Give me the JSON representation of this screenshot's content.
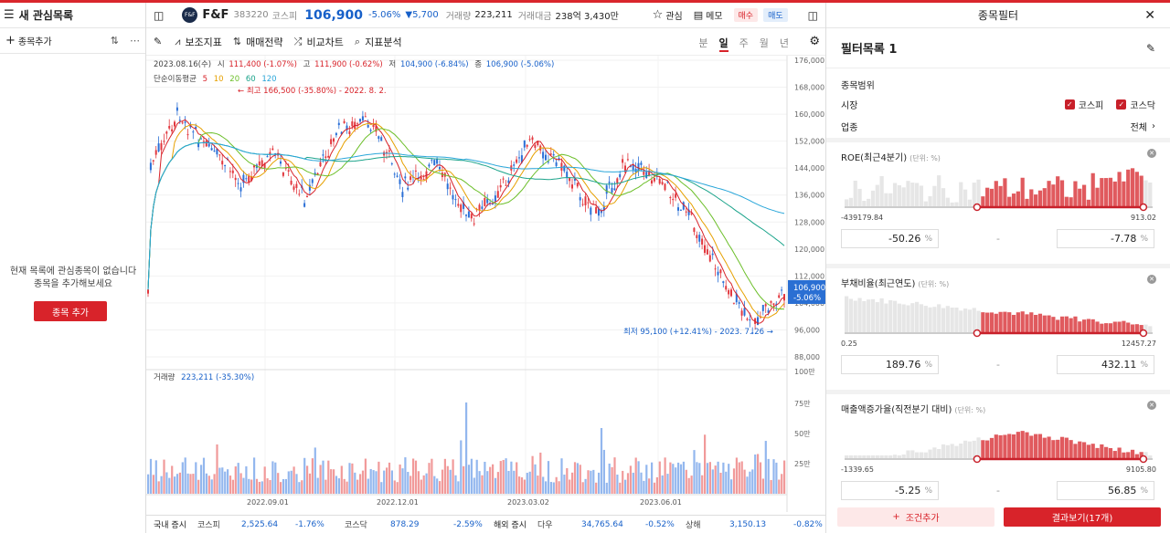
{
  "watchlist": {
    "title": "새 관심목록",
    "add_label": "종목추가",
    "empty_line1": "현재 목록에 관심종목이 없습니다",
    "empty_line2": "종목을 추가해보세요",
    "add_button": "종목 추가"
  },
  "stock": {
    "logo": "F&F",
    "name": "F&F",
    "code": "383220",
    "market": "코스피",
    "price": "106,900",
    "change_pct": "-5.06%",
    "change_abs": "▼5,700",
    "volume_label": "거래량",
    "volume": "223,211",
    "amount_label": "거래대금",
    "amount": "238억 3,430만",
    "fav_label": "관심",
    "memo_label": "메모",
    "buy_label": "매수",
    "sell_label": "매도"
  },
  "toolbar": {
    "items": [
      "보조지표",
      "매매전략",
      "비교차트",
      "지표분석"
    ],
    "periods": [
      "분",
      "일",
      "주",
      "월",
      "년"
    ],
    "active_period": "일"
  },
  "chart_info": {
    "date": "2023.08.16(수)",
    "open_label": "시",
    "open": "111,400 (-1.07%)",
    "high_label": "고",
    "high": "111,900 (-0.62%)",
    "low_label": "저",
    "low": "104,900 (-6.84%)",
    "close_label": "종",
    "close": "106,900 (-5.06%)",
    "ma_label": "단순이동평균",
    "ma_periods": [
      "5",
      "10",
      "20",
      "60",
      "120"
    ],
    "ma_colors": [
      "#d8232a",
      "#e6a000",
      "#6cbf2a",
      "#1aa38a",
      "#29a6d9"
    ],
    "max_note": "← 최고 166,500 (-35.80%) - 2022. 8. 2.",
    "min_note": "최저 95,100 (+12.41%) - 2023. 7. 26 →",
    "vol_label": "거래량",
    "vol_value": "223,211 (-35.30%)",
    "price_tag": "106,900",
    "price_tag_pct": "-5.06%"
  },
  "chart_data": {
    "type": "line",
    "price_axis": [
      "176,000",
      "168,000",
      "160,000",
      "152,000",
      "144,000",
      "136,000",
      "128,000",
      "120,000",
      "112,000",
      "104,000",
      "96,000",
      "88,000"
    ],
    "ylim": [
      88000,
      176000
    ],
    "volume_axis": [
      "100만",
      "75만",
      "50만",
      "25만"
    ],
    "x_ticks": [
      "2022.09.01",
      "2022.12.01",
      "2023.03.02",
      "2023.06.01"
    ],
    "x": [
      "2022-07-15",
      "2022-08-02",
      "2022-08-20",
      "2022-09-10",
      "2022-10-01",
      "2022-10-20",
      "2022-11-10",
      "2022-12-01",
      "2022-12-20",
      "2023-01-10",
      "2023-02-01",
      "2023-02-20",
      "2023-03-10",
      "2023-03-30",
      "2023-04-20",
      "2023-05-10",
      "2023-06-01",
      "2023-06-20",
      "2023-07-10",
      "2023-07-26",
      "2023-08-16"
    ],
    "series": [
      {
        "name": "close",
        "values": [
          144000,
          160000,
          150000,
          140000,
          148000,
          135000,
          155000,
          158000,
          138000,
          145000,
          128000,
          138000,
          152000,
          145000,
          130000,
          146000,
          140000,
          128000,
          110000,
          97000,
          106900
        ]
      }
    ]
  },
  "market_bar": [
    {
      "label": "국내 증시",
      "color": "#222"
    },
    {
      "label": "코스피",
      "color": "#444"
    },
    {
      "label": "2,525.64",
      "color": "#1760c9"
    },
    {
      "label": "-1.76%",
      "color": "#1760c9"
    },
    {
      "label": "코스닥",
      "color": "#444"
    },
    {
      "label": "878.29",
      "color": "#1760c9"
    },
    {
      "label": "-2.59%",
      "color": "#1760c9"
    },
    {
      "label": "해외 증시",
      "color": "#222"
    },
    {
      "label": "다우",
      "color": "#444"
    },
    {
      "label": "34,765.64",
      "color": "#1760c9"
    },
    {
      "label": "-0.52%",
      "color": "#1760c9"
    },
    {
      "label": "상해",
      "color": "#444"
    },
    {
      "label": "3,150.13",
      "color": "#1760c9"
    },
    {
      "label": "-0.82%",
      "color": "#1760c9"
    }
  ],
  "filter": {
    "header": "종목필터",
    "list_name": "필터목록 1",
    "range_title": "종목범위",
    "market_label": "시장",
    "kospi": "코스피",
    "kosdaq": "코스닥",
    "sector_label": "업종",
    "sector_value": "전체",
    "blocks": [
      {
        "title": "ROE(최근4분기)",
        "unit": "(단위: %)",
        "min": "-439179.84",
        "max": "913.02",
        "from": "-50.26",
        "to": "-7.78",
        "sel": [
          0.43,
          0.97
        ]
      },
      {
        "title": "부채비율(최근연도)",
        "unit": "(단위: %)",
        "min": "0.25",
        "max": "12457.27",
        "from": "189.76",
        "to": "432.11",
        "sel": [
          0.43,
          0.97
        ]
      },
      {
        "title": "매출액증가율(직전분기 대비)",
        "unit": "(단위: %)",
        "min": "-1339.65",
        "max": "9105.80",
        "from": "-5.25",
        "to": "56.85",
        "sel": [
          0.43,
          0.97
        ]
      }
    ],
    "unit_sign": "%",
    "add_condition": "조건추가",
    "result_button": "결과보기(17개)"
  }
}
